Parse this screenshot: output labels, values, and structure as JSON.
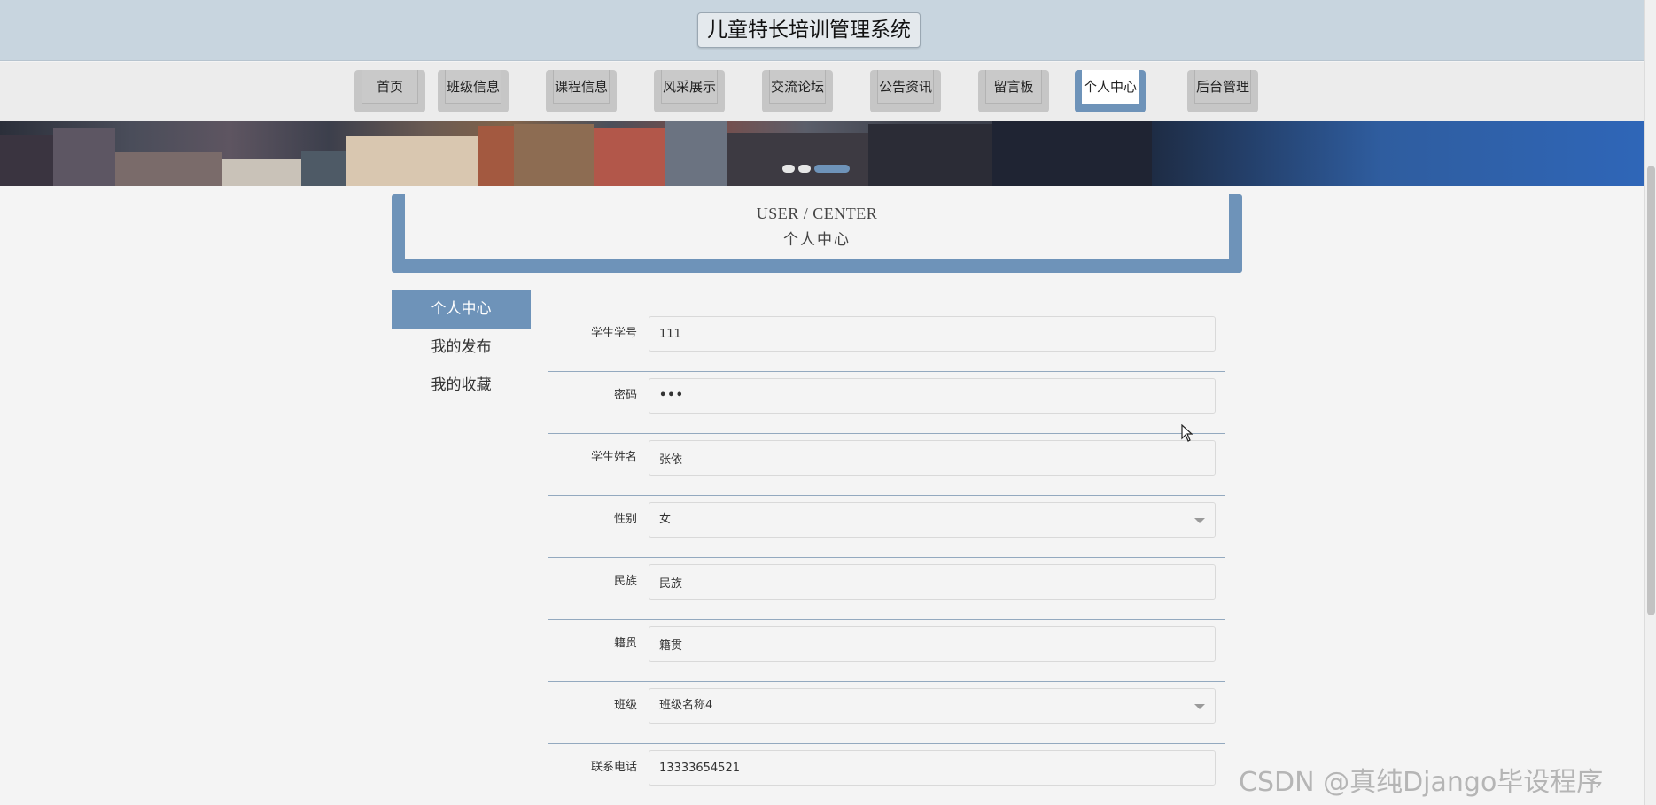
{
  "app": {
    "title": "儿童特长培训管理系统"
  },
  "nav": {
    "items": [
      {
        "label": "首页",
        "active": false
      },
      {
        "label": "班级信息",
        "active": false
      },
      {
        "label": "课程信息",
        "active": false
      },
      {
        "label": "风采展示",
        "active": false
      },
      {
        "label": "交流论坛",
        "active": false
      },
      {
        "label": "公告资讯",
        "active": false
      },
      {
        "label": "留言板",
        "active": false
      },
      {
        "label": "个人中心",
        "active": true
      },
      {
        "label": "后台管理",
        "active": false
      }
    ]
  },
  "section": {
    "title_en": "USER / CENTER",
    "title_cn": "个人中心"
  },
  "sidebar": {
    "items": [
      {
        "label": "个人中心",
        "active": true
      },
      {
        "label": "我的发布",
        "active": false
      },
      {
        "label": "我的收藏",
        "active": false
      }
    ]
  },
  "form": {
    "fields": [
      {
        "label": "学生学号",
        "value": "111",
        "type": "text"
      },
      {
        "label": "密码",
        "value": "•••",
        "type": "password"
      },
      {
        "label": "学生姓名",
        "value": "张依",
        "type": "text"
      },
      {
        "label": "性别",
        "value": "女",
        "type": "select"
      },
      {
        "label": "民族",
        "value": "民族",
        "type": "text"
      },
      {
        "label": "籍贯",
        "value": "籍贯",
        "type": "text"
      },
      {
        "label": "班级",
        "value": "班级名称4",
        "type": "select"
      },
      {
        "label": "联系电话",
        "value": "13333654521",
        "type": "text"
      }
    ]
  },
  "watermark": "CSDN @真纯Django毕设程序",
  "colors": {
    "accent": "#6e93b9",
    "header_bg": "#c8d5df",
    "page_bg": "#f4f4f4"
  }
}
